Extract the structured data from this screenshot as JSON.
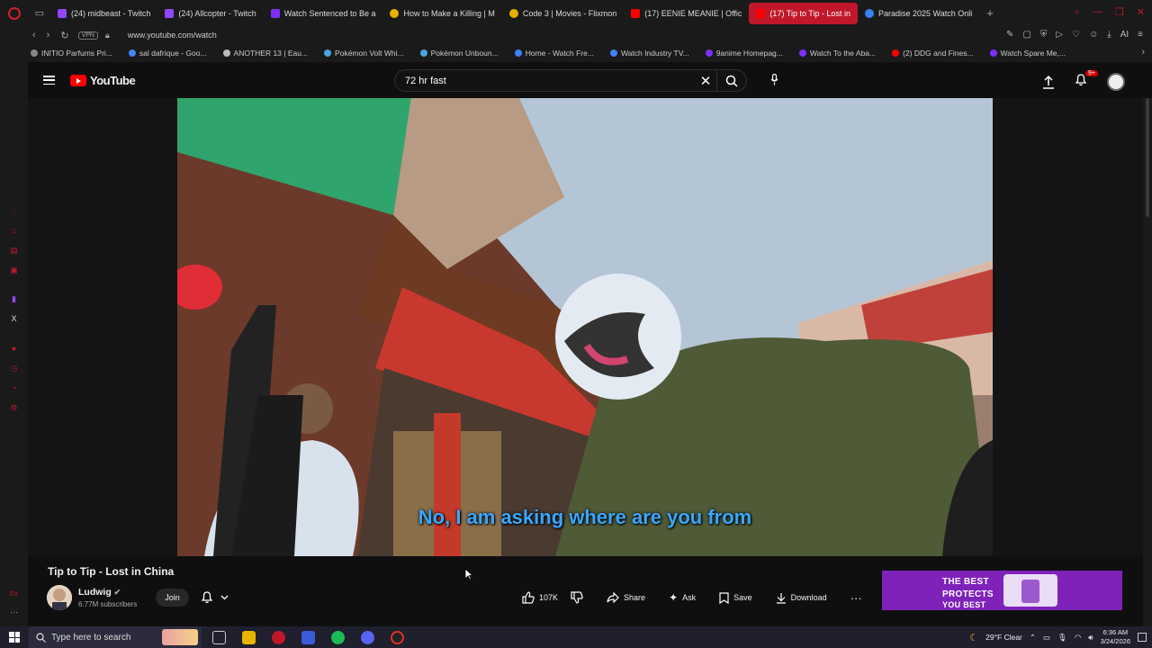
{
  "browser": {
    "tabs": [
      {
        "label": "(24) midbeast - Twitch",
        "color": "#9146ff"
      },
      {
        "label": "(24) Allcopter - Twitch",
        "color": "#9146ff"
      },
      {
        "label": "Watch Sentenced to Be a",
        "color": "#7b2ff7"
      },
      {
        "label": "How to Make a Killing | M",
        "color": "#e5b100"
      },
      {
        "label": "Code 3 | Movies - Flixmon",
        "color": "#e5b100"
      },
      {
        "label": "(17) EENIE MEANIE | Offic",
        "color": "#ff0000"
      },
      {
        "label": "(17) Tip to Tip - Lost in",
        "color": "#ff0000"
      },
      {
        "label": "Paradise 2025 Watch Onli",
        "color": "#3b82f6"
      }
    ],
    "url": "www.youtube.com/watch",
    "vpn_label": "VPN",
    "bookmarks": [
      {
        "label": "INITIO Parfums Pri...",
        "color": "#888"
      },
      {
        "label": "sal dafrique - Goo...",
        "color": "#4285f4"
      },
      {
        "label": "ANOTHER 13 | Eau...",
        "color": "#bbb"
      },
      {
        "label": "Pokémon Volt Whi...",
        "color": "#4aa3df"
      },
      {
        "label": "Pokémon Unboun...",
        "color": "#4aa3df"
      },
      {
        "label": "Home - Watch Fre...",
        "color": "#3b82f6"
      },
      {
        "label": "Watch Industry TV...",
        "color": "#3b82f6"
      },
      {
        "label": "9anime Homepag...",
        "color": "#7b2ff7"
      },
      {
        "label": "Watch To the Aba...",
        "color": "#7b2ff7"
      },
      {
        "label": "(2) DDG and Fines...",
        "color": "#ff0000"
      },
      {
        "label": "Watch Spare Me,...",
        "color": "#7b2ff7"
      }
    ]
  },
  "youtube": {
    "logo_text": "YouTube",
    "search_query": "72 hr fast",
    "notification_badge": "9+",
    "subtitle": "No, I am asking where are you from",
    "video_title": "Tip to Tip - Lost in China",
    "channel": {
      "name": "Ludwig",
      "subscribers": "6.77M subscribers",
      "join_label": "Join"
    },
    "actions": {
      "likes": "107K",
      "share": "Share",
      "ask": "Ask",
      "save": "Save",
      "download": "Download"
    },
    "ad": {
      "line1": "THE BEST",
      "line2": "PROTECTS",
      "line3": "YOU BEST"
    }
  },
  "taskbar": {
    "search_placeholder": "Type here to search",
    "weather": "29°F  Clear",
    "time": "6:36 AM",
    "date": "3/24/2026"
  },
  "colors": {
    "accent": "#c0182a",
    "youtube_red": "#ff0000",
    "subtitle_blue": "#3aa7ff",
    "ad_purple": "#7e22b9"
  }
}
